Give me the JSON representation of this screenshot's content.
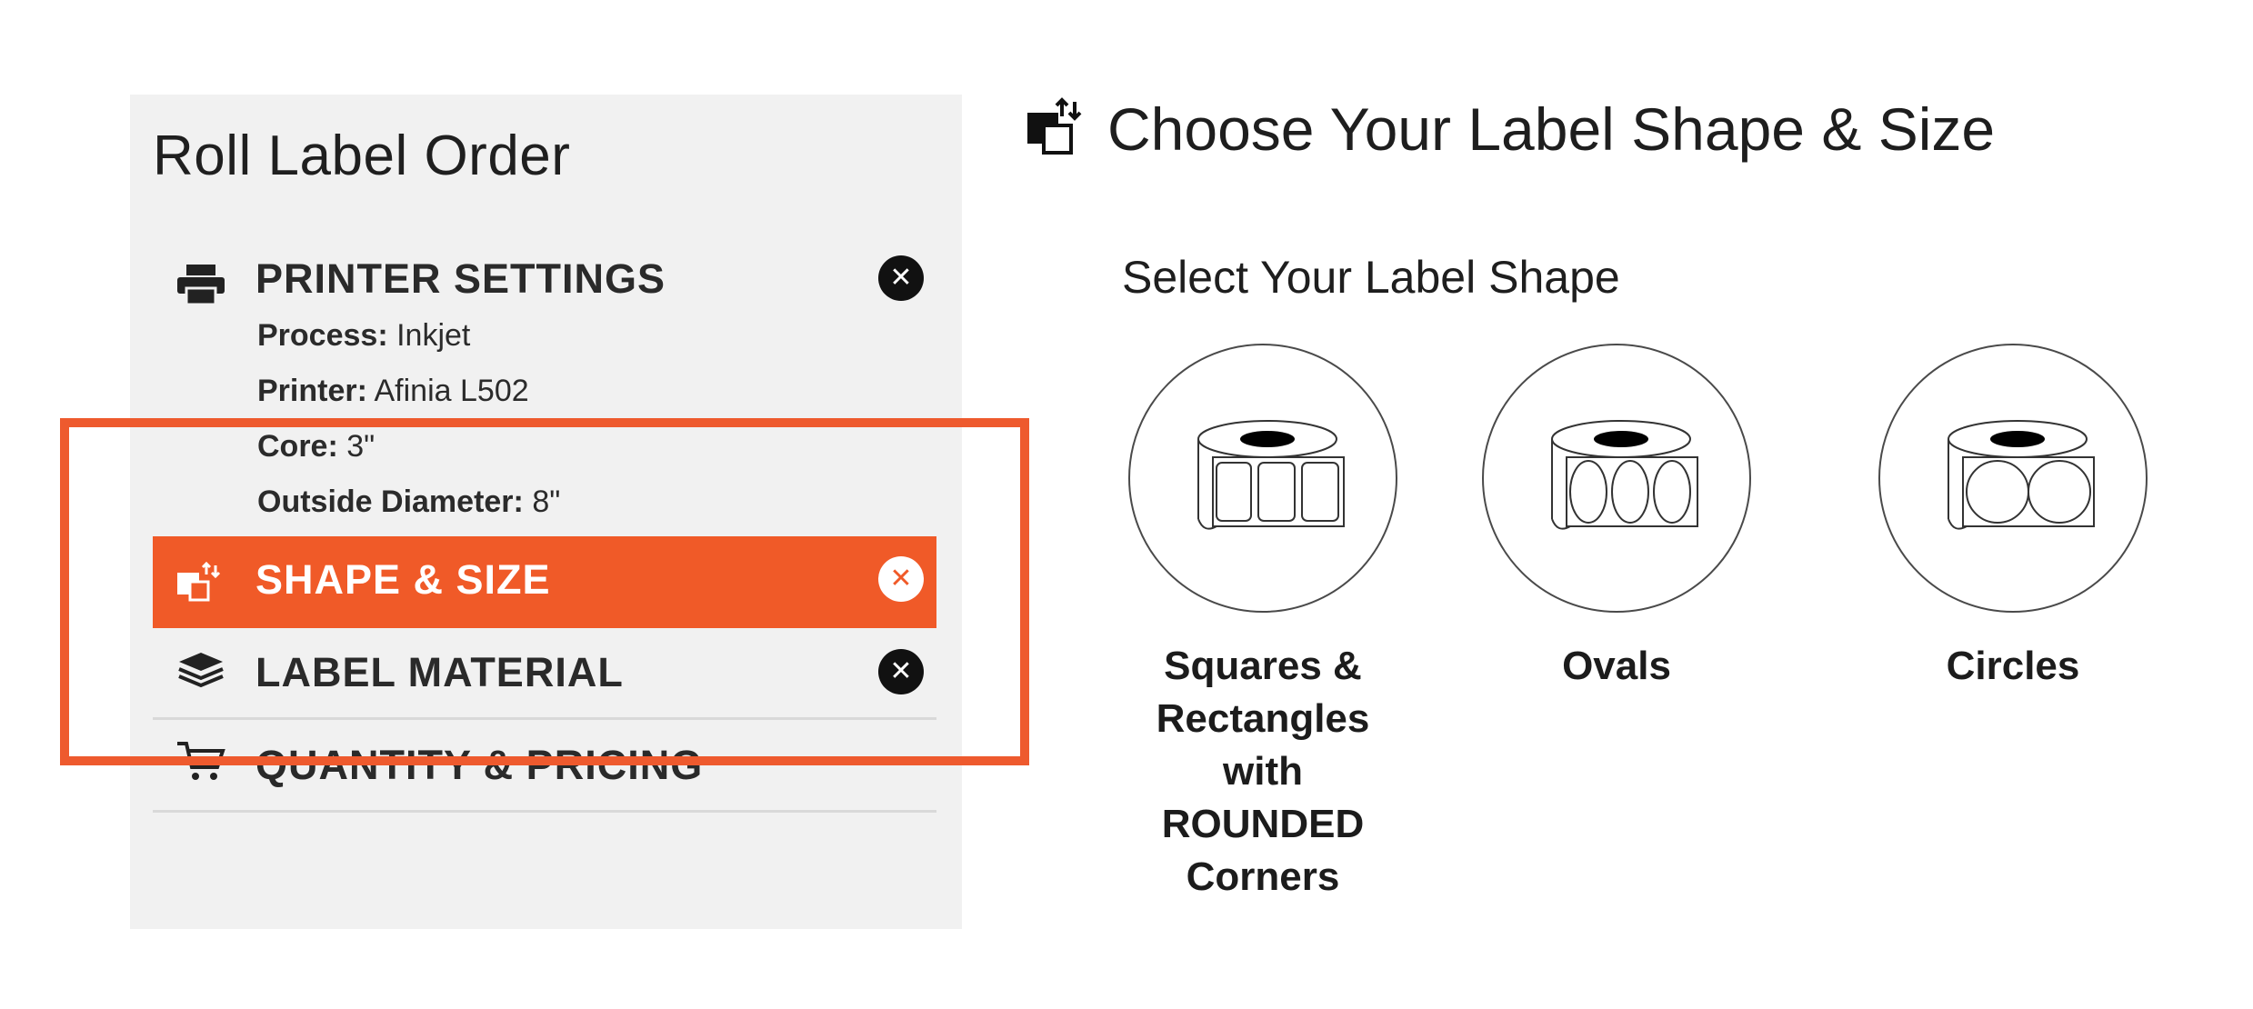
{
  "sidebar": {
    "title": "Roll Label Order",
    "steps": [
      {
        "label": "PRINTER SETTINGS",
        "icon": "printer-icon",
        "remove": "✕",
        "details": [
          {
            "key": "Process:",
            "value": "Inkjet"
          },
          {
            "key": "Printer:",
            "value": "Afinia L502"
          },
          {
            "key": "Core:",
            "value": "3\""
          },
          {
            "key": "Outside Diameter:",
            "value": "8\""
          }
        ]
      },
      {
        "label": "SHAPE & SIZE",
        "icon": "shape-size-icon",
        "remove": "✕",
        "active": true
      },
      {
        "label": "LABEL MATERIAL",
        "icon": "layers-icon",
        "remove": "✕"
      },
      {
        "label": "QUANTITY & PRICING",
        "icon": "cart-icon"
      }
    ]
  },
  "main": {
    "title": "Choose Your Label Shape & Size",
    "subtitle": "Select Your Label Shape",
    "shapes": [
      {
        "label": "Squares & Rectangles with ROUNDED Corners",
        "icon": "rounded-rectangles-roll-icon"
      },
      {
        "label": "Ovals",
        "icon": "ovals-roll-icon"
      },
      {
        "label": "Circles",
        "icon": "circles-roll-icon"
      }
    ]
  },
  "colors": {
    "accent": "#f05a28",
    "highlight": "#ee5a2e",
    "sidebar_bg": "#f1f1f1"
  }
}
